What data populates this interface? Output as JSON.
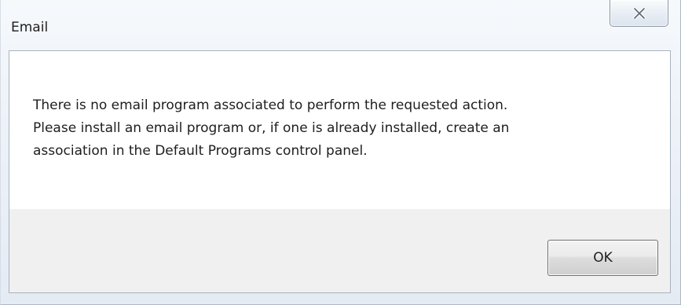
{
  "window": {
    "title": "Email"
  },
  "titlebar": {
    "close_icon": "close-icon"
  },
  "dialog": {
    "message_lines": [
      "There is no email program associated to perform the requested action.",
      "Please install an email program or, if one is already installed, create an",
      "association in the Default Programs control panel."
    ],
    "ok_label": "OK"
  },
  "colors": {
    "footer_background": "#f0f0f0",
    "content_background": "#ffffff",
    "text": "#1e1e1e"
  }
}
